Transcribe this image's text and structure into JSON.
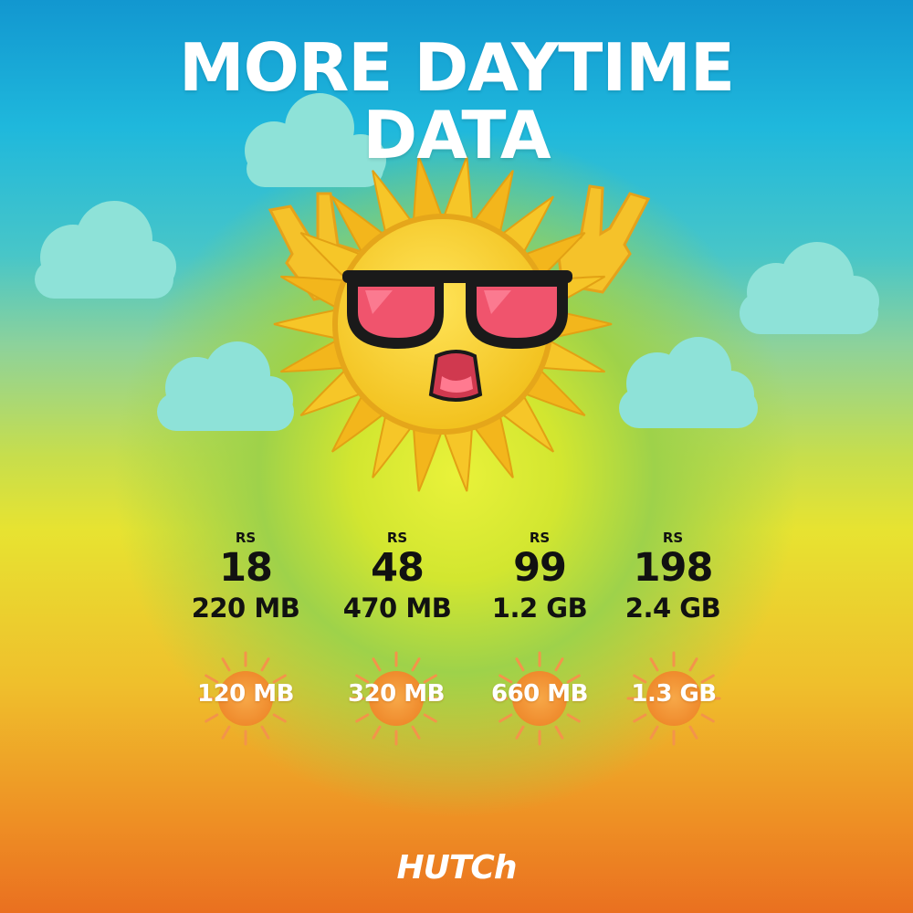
{
  "headline": {
    "line1": "MORE DAYTIME",
    "line2": "DATA"
  },
  "plans": [
    {
      "currency": "RS",
      "price": "18",
      "data": "220 MB",
      "daytime_bonus": "120 MB"
    },
    {
      "currency": "RS",
      "price": "48",
      "data": "470 MB",
      "daytime_bonus": "320 MB"
    },
    {
      "currency": "RS",
      "price": "99",
      "data": "1.2 GB",
      "daytime_bonus": "660 MB"
    },
    {
      "currency": "RS",
      "price": "198",
      "data": "2.4 GB",
      "daytime_bonus": "1.3 GB"
    }
  ],
  "brand": {
    "logo_text": "HUTCh"
  },
  "icons": [
    "cloud-icon",
    "sun-mascot-illustration",
    "sunglasses-icon",
    "rock-hand-icon",
    "small-sun-icon"
  ],
  "colors": {
    "sky_top": "#1297d0",
    "glow": "#e9f23a",
    "bottom": "#ea7020",
    "cloud": "#8ee2d8",
    "sun_body": "#f6cf2c",
    "lens": "#f0546d",
    "small_sun": "#f39a3a"
  }
}
